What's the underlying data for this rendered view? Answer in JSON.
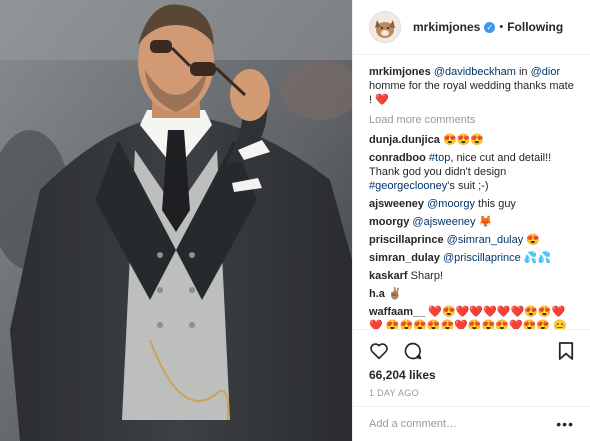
{
  "post": {
    "username": "mrkimjones",
    "follow_label": "Following",
    "separator": "•",
    "verified_mark": "✓",
    "caption": {
      "user": "mrkimjones",
      "mention1": "@davidbeckham",
      "mid": " in ",
      "mention2": "@dior",
      "text": " homme for the royal wedding thanks mate !",
      "emoji": "❤️"
    },
    "load_more": "Load more comments",
    "comments": [
      {
        "user": "dunja.dunjica",
        "text": "😍😍😍"
      },
      {
        "user": "conradboo",
        "tag": "#top",
        "text": ", nice cut and detail!! Thank god you didn't design ",
        "tag2": "#georgeclooney",
        "text2": "'s suit ;-)"
      },
      {
        "user": "ajsweeney",
        "tag": "@moorgy",
        "text": " this guy"
      },
      {
        "user": "moorgy",
        "tag": "@ajsweeney",
        "text": " 🦊"
      },
      {
        "user": "priscillaprince",
        "tag": "@simran_dulay",
        "text": " 😍"
      },
      {
        "user": "simran_dulay",
        "tag": "@priscillaprince",
        "text": " 💦💦"
      },
      {
        "user": "kaskarf",
        "text": "Sharp!"
      },
      {
        "user": "h.a",
        "text": "✌🏽"
      },
      {
        "user": "waffaam__",
        "text": "❤️😍❤️❤️❤️❤️❤️😍😍❤️❤️ 😍😍😍😍😍❤️😍😍😍❤️😍😍 😊😊😍😍❤️😍😍😍❤️😍❤️😍 😍😍😍😍😍😍😍😍😍😍😍😍"
      }
    ],
    "likes": "66,204 likes",
    "time_ago": "1 DAY AGO",
    "add_comment_placeholder": "Add a comment…",
    "more_label": "•••"
  },
  "colors": {
    "accent": "#3897f0",
    "link": "#003569",
    "heart": "#ed4956",
    "muted": "#999999"
  },
  "icons": [
    "heart-icon",
    "comment-icon",
    "bookmark-icon",
    "verified-icon"
  ]
}
